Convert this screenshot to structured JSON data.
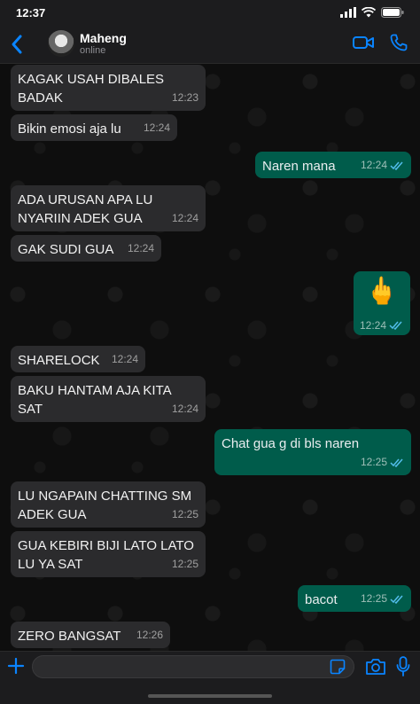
{
  "status_bar": {
    "time": "12:37"
  },
  "header": {
    "contact_name": "Maheng",
    "contact_status": "online"
  },
  "icons": {
    "back": "chevron-left-icon",
    "video_call": "video-camera-icon",
    "voice_call": "phone-icon",
    "attach": "plus-icon",
    "sticker": "sticker-icon",
    "camera": "camera-icon",
    "mic": "microphone-icon"
  },
  "colors": {
    "accent": "#0a84ff",
    "incoming_bubble": "#2b2b2d",
    "outgoing_bubble": "#005c4b",
    "read_ticks": "#53bdeb"
  },
  "messages": [
    {
      "dir": "in",
      "text": "KAGAK USAH DIBALES BADAK",
      "time": "12:23"
    },
    {
      "dir": "in",
      "text": "Bikin emosi aja lu",
      "time": "12:24"
    },
    {
      "dir": "out",
      "text": "Naren mana",
      "time": "12:24",
      "read": true
    },
    {
      "dir": "in",
      "text": "ADA URUSAN APA LU NYARIIN ADEK GUA",
      "time": "12:24"
    },
    {
      "dir": "in",
      "text": "GAK SUDI GUA",
      "time": "12:24"
    },
    {
      "dir": "out",
      "text": "🖕",
      "time": "12:24",
      "read": true
    },
    {
      "dir": "in",
      "text": "SHARELOCK",
      "time": "12:24"
    },
    {
      "dir": "in",
      "text": "BAKU HANTAM AJA KITA SAT",
      "time": "12:24"
    },
    {
      "dir": "out",
      "text": "Chat gua g di bls naren",
      "time": "12:25",
      "read": true
    },
    {
      "dir": "in",
      "text": "LU NGAPAIN CHATTING SM ADEK GUA",
      "time": "12:25"
    },
    {
      "dir": "in",
      "text": "GUA KEBIRI BIJI LATO LATO LU YA SAT",
      "time": "12:25"
    },
    {
      "dir": "out",
      "text": "bacot",
      "time": "12:25",
      "read": true
    },
    {
      "dir": "in",
      "text": "ZERO BANGSAT",
      "time": "12:26"
    }
  ],
  "input": {
    "value": "",
    "placeholder": ""
  }
}
